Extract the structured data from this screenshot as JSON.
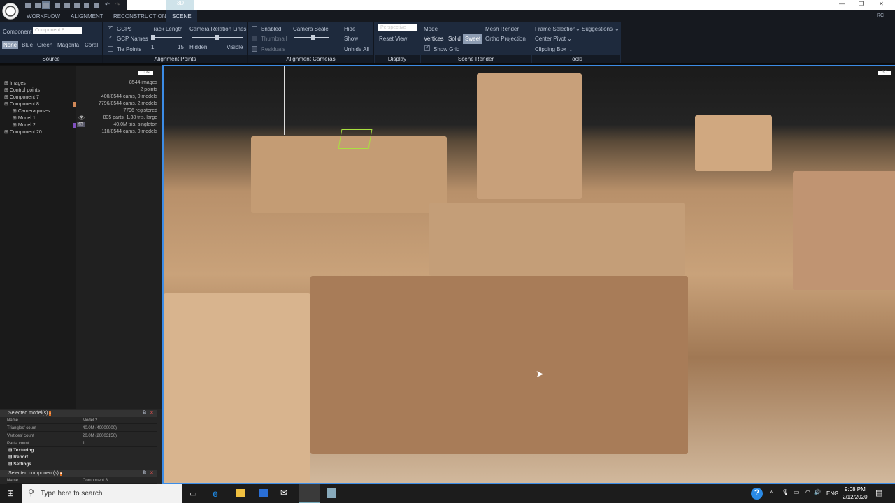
{
  "tabs": [
    "WORKFLOW",
    "ALIGNMENT",
    "RECONSTRUCTION",
    "SCENE"
  ],
  "quick_tab": "3D",
  "source": {
    "label": "Component",
    "value": "Component 8",
    "colors": [
      "None",
      "Blue",
      "Green",
      "Magenta",
      "Coral"
    ],
    "title": "Source"
  },
  "alignment_points": {
    "gcps": "GCPs",
    "gcp_names": "GCP Names",
    "tie_points": "Tie Points",
    "track_length": "Track Length",
    "track_min": "1",
    "track_max": "15",
    "relation": "Camera Relation Lines",
    "hidden": "Hidden",
    "visible": "Visible",
    "title": "Alignment Points"
  },
  "alignment_cameras": {
    "enabled": "Enabled",
    "thumbnail": "Thumbnail",
    "residuals": "Residuals",
    "scale": "Camera Scale",
    "hide": "Hide",
    "show": "Show",
    "unhide": "Unhide All",
    "title": "Alignment Cameras"
  },
  "display": {
    "projection": "Perspective",
    "reset": "Reset View",
    "title": "Display"
  },
  "scene_render": {
    "mode": "Mode",
    "vertices": "Vertices",
    "solid": "Solid",
    "sweet": "Sweet",
    "mesh": "Mesh Render",
    "ortho": "Ortho Projection",
    "grid": "Show Grid",
    "title": "Scene Render"
  },
  "tools": {
    "frame": "Frame Selection",
    "suggestions": "Suggestions",
    "pivot": "Center Pivot",
    "clipping": "Clipping Box",
    "title": "Tools"
  },
  "tree_button": "1Ds",
  "tree": [
    {
      "label": "Images",
      "value": "8544 images"
    },
    {
      "label": "Control points",
      "value": "2 points"
    },
    {
      "label": "Component 7",
      "value": "400/8544 cams, 0 models"
    },
    {
      "label": "Component 8",
      "value": "7796/8544 cams, 2 models"
    },
    {
      "label": "Camera poses",
      "value": "7796 registered"
    },
    {
      "label": "Model 1",
      "value": "835 parts, 1.38 tris, large"
    },
    {
      "label": "Model 2",
      "value": "40.0M tris, singleton"
    },
    {
      "label": "Component 20",
      "value": "110/8544 cams, 0 models"
    }
  ],
  "selected_model": {
    "title": "Selected model(s)",
    "rows": [
      [
        "Name",
        "Model 2"
      ],
      [
        "Triangles' count",
        "40.0M (40000000)"
      ],
      [
        "Vertices' count",
        "20.0M (20003150)"
      ],
      [
        "Parts' count",
        "1"
      ]
    ],
    "groups": [
      "Texturing",
      "Report",
      "Settings"
    ]
  },
  "selected_component": {
    "title": "Selected component(s)",
    "rows": [
      [
        "Name",
        "Component 8"
      ]
    ]
  },
  "view_badge": "3D",
  "taskbar": {
    "search": "Type here to search",
    "lang": "ENG",
    "time": "9:08 PM",
    "date": "2/12/2020"
  }
}
